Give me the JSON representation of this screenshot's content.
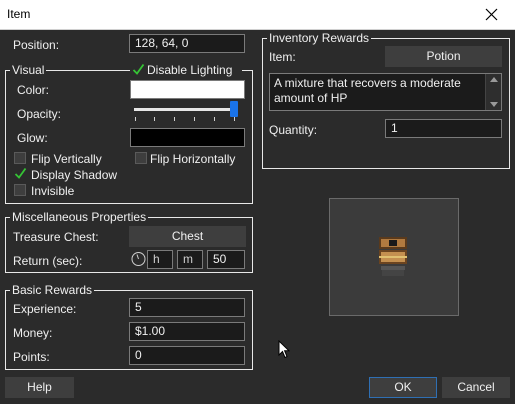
{
  "window": {
    "title": "Item"
  },
  "position": {
    "label": "Position:",
    "value": "128, 64, 0"
  },
  "visual": {
    "legend": "Visual",
    "disable_lighting": {
      "label": "Disable Lighting",
      "checked": true
    },
    "color_label": "Color:",
    "color_value": "#ffffff",
    "opacity_label": "Opacity:",
    "opacity_value": 1.0,
    "glow_label": "Glow:",
    "glow_value": "#000000",
    "flip_vertically": {
      "label": "Flip Vertically",
      "checked": false
    },
    "flip_horizontally": {
      "label": "Flip Horizontally",
      "checked": false
    },
    "display_shadow": {
      "label": "Display Shadow",
      "checked": true
    },
    "invisible": {
      "label": "Invisible",
      "checked": false
    }
  },
  "misc": {
    "legend": "Miscellaneous Properties",
    "treasure_chest_label": "Treasure Chest:",
    "treasure_chest_value": "Chest",
    "return_label": "Return (sec):",
    "return_h_placeholder": "h",
    "return_m_placeholder": "m",
    "return_s_value": "50"
  },
  "basic_rewards": {
    "legend": "Basic Rewards",
    "experience_label": "Experience:",
    "experience_value": "5",
    "money_label": "Money:",
    "money_value": "$1.00",
    "points_label": "Points:",
    "points_value": "0"
  },
  "inventory_rewards": {
    "legend": "Inventory Rewards",
    "item_label": "Item:",
    "item_value": "Potion",
    "description": "A mixture that recovers a moderate amount of HP",
    "quantity_label": "Quantity:",
    "quantity_value": "1"
  },
  "buttons": {
    "help": "Help",
    "ok": "OK",
    "cancel": "Cancel"
  },
  "colors": {
    "background": "#2b2b2b",
    "accent": "#1a73e8",
    "focus_border": "#2f6fb3"
  }
}
